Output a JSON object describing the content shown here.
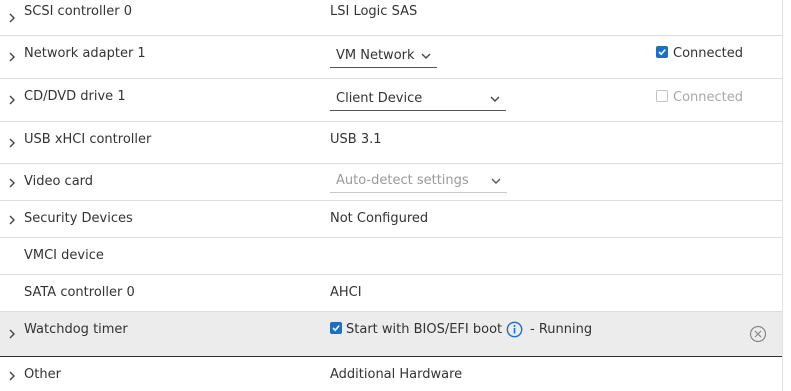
{
  "rows": [
    {
      "label": "SCSI controller 0",
      "value": "LSI Logic SAS"
    },
    {
      "label": "Network adapter 1",
      "select": "VM Network",
      "checkbox_label": "Connected"
    },
    {
      "label": "CD/DVD drive 1",
      "select": "Client Device",
      "checkbox_label": "Connected"
    },
    {
      "label": "USB xHCI controller",
      "value": "USB 3.1"
    },
    {
      "label": "Video card",
      "select": "Auto-detect settings"
    },
    {
      "label": "Security Devices",
      "value": "Not Configured"
    },
    {
      "label": "VMCI device",
      "value": ""
    },
    {
      "label": "SATA controller 0",
      "value": "AHCI"
    },
    {
      "label": "Watchdog timer",
      "checkbox_label": "Start with BIOS/EFI boot",
      "status": "- Running"
    },
    {
      "label": "Other",
      "value": "Additional Hardware"
    }
  ],
  "colors": {
    "accent": "#1a6fc9",
    "row_highlight": "#ececec"
  }
}
